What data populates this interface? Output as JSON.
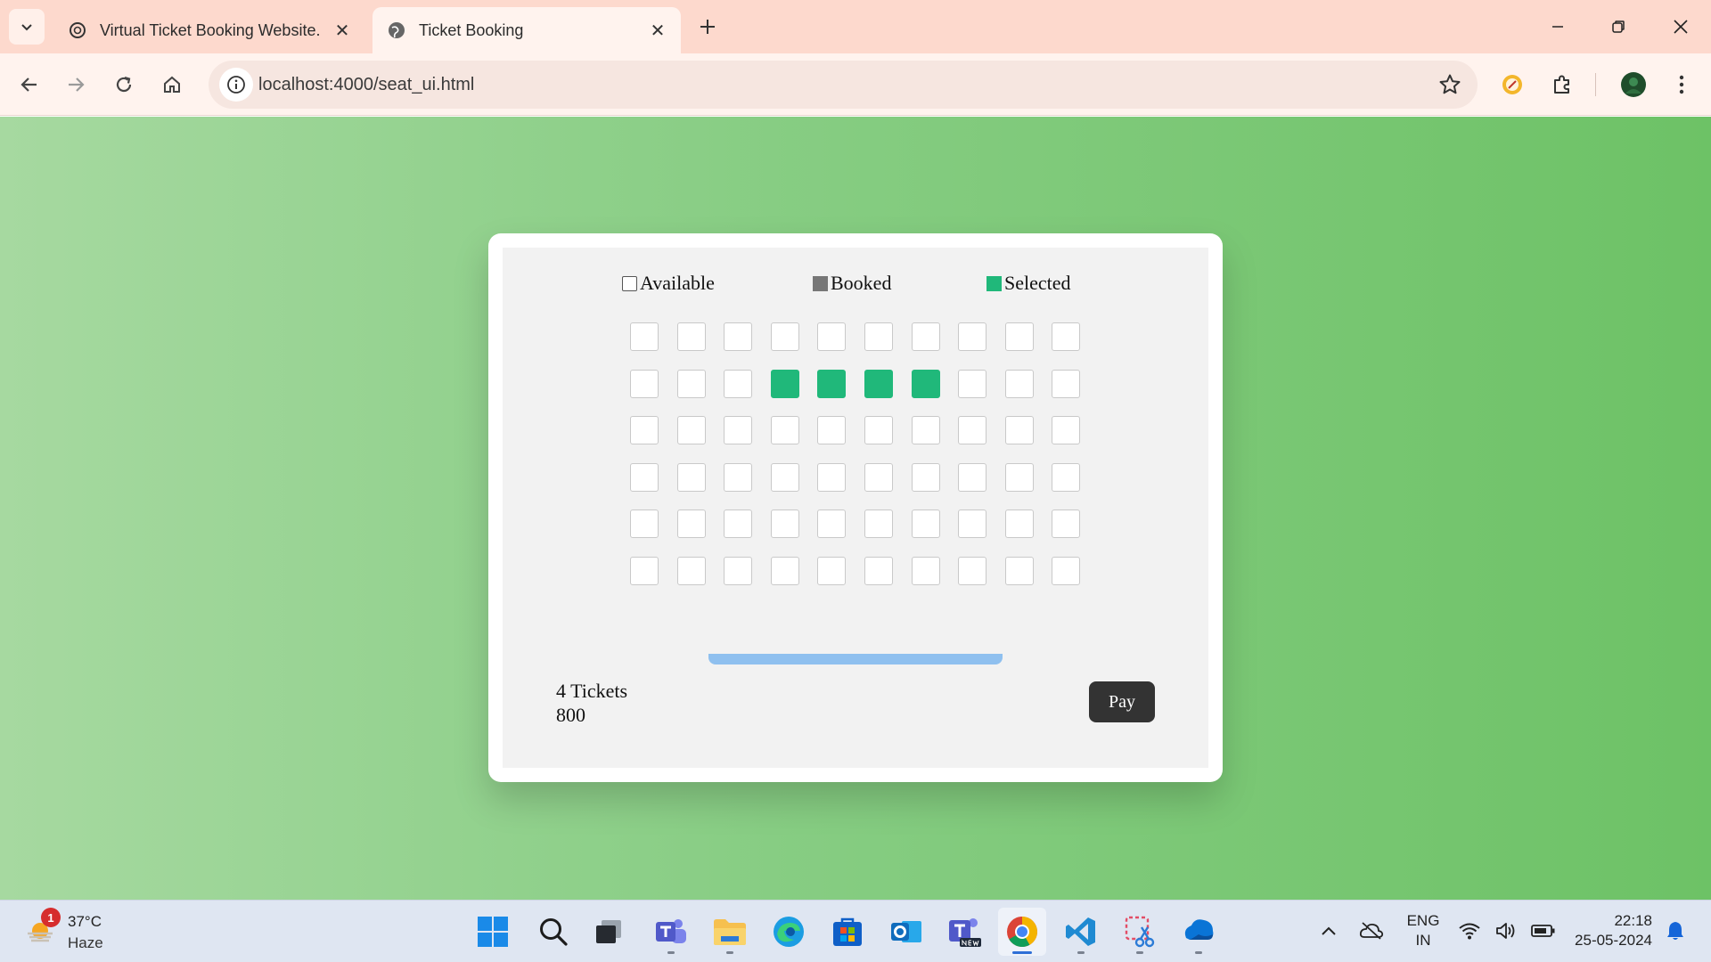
{
  "browser": {
    "tabs": [
      {
        "title": "Virtual Ticket Booking Website.",
        "active": false
      },
      {
        "title": "Ticket Booking",
        "active": true
      }
    ],
    "url": "localhost:4000/seat_ui.html"
  },
  "legend": {
    "available": "Available",
    "booked": "Booked",
    "selected": "Selected"
  },
  "seats": {
    "rows": [
      [
        "available",
        "available",
        "available",
        "available",
        "available",
        "available",
        "available",
        "available",
        "available",
        "available"
      ],
      [
        "available",
        "available",
        "available",
        "selected",
        "selected",
        "selected",
        "selected",
        "available",
        "available",
        "available"
      ],
      [
        "available",
        "available",
        "available",
        "available",
        "available",
        "available",
        "available",
        "available",
        "available",
        "available"
      ],
      [
        "available",
        "available",
        "available",
        "available",
        "available",
        "available",
        "available",
        "available",
        "available",
        "available"
      ],
      [
        "available",
        "available",
        "available",
        "available",
        "available",
        "available",
        "available",
        "available",
        "available",
        "available"
      ],
      [
        "available",
        "available",
        "available",
        "available",
        "available",
        "available",
        "available",
        "available",
        "available",
        "available"
      ]
    ]
  },
  "summary": {
    "tickets": "4 Tickets",
    "total": "800",
    "pay_label": "Pay"
  },
  "colors": {
    "selected": "#20b87a",
    "booked": "#777777",
    "screen": "#8fc0ef",
    "background_from": "#a6d9a0",
    "background_to": "#6dc266"
  },
  "taskbar": {
    "weather_badge": "1",
    "weather_temp": "37°C",
    "weather_condition": "Haze",
    "lang_line1": "ENG",
    "lang_line2": "IN",
    "time": "22:18",
    "date": "25-05-2024",
    "apps": [
      "start-icon",
      "search-icon",
      "task-view-icon",
      "teams-icon",
      "file-explorer-icon",
      "edge-icon",
      "store-icon",
      "outlook-icon",
      "teams-new-icon",
      "chrome-icon",
      "vscode-icon",
      "snipping-tool-icon",
      "onedrive-app-icon"
    ]
  }
}
